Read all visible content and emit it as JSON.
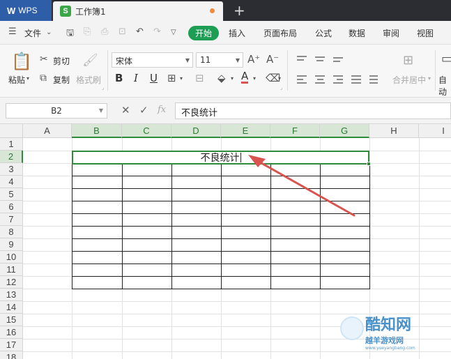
{
  "titlebar": {
    "app_logo": "W",
    "app_name": "WPS",
    "doc_badge": "S",
    "doc_title": "工作簿1",
    "new_tab": "+"
  },
  "menu": {
    "file": "文件",
    "tabs": [
      "开始",
      "插入",
      "页面布局",
      "公式",
      "数据",
      "审阅",
      "视图"
    ]
  },
  "ribbon": {
    "paste": "粘贴",
    "cut": "剪切",
    "copy": "复制",
    "format_painter": "格式刷",
    "font_name": "宋体",
    "font_size": "11",
    "bold": "B",
    "italic": "I",
    "underline": "U",
    "font_color": "A",
    "merge_center": "合并居中",
    "wrap": "自动"
  },
  "formula_bar": {
    "cell_ref": "B2",
    "fx": "fx",
    "content": "不良统计"
  },
  "grid": {
    "columns": [
      "A",
      "B",
      "C",
      "D",
      "E",
      "F",
      "G",
      "H",
      "I"
    ],
    "rows": [
      "1",
      "2",
      "3",
      "4",
      "5",
      "6",
      "7",
      "8",
      "9",
      "10",
      "11",
      "12",
      "13",
      "14",
      "15",
      "16",
      "17",
      "18"
    ],
    "merged_cell_text": "不良统计"
  },
  "watermark": {
    "line1": "酷知网",
    "line2": "越羊游戏网",
    "line3": "www.yueyangbang.com"
  },
  "colors": {
    "accent_green": "#1e9e54",
    "selection_green": "#2e8b3a",
    "arrow_red": "#d9534f",
    "wps_blue": "#2f5ea8"
  }
}
